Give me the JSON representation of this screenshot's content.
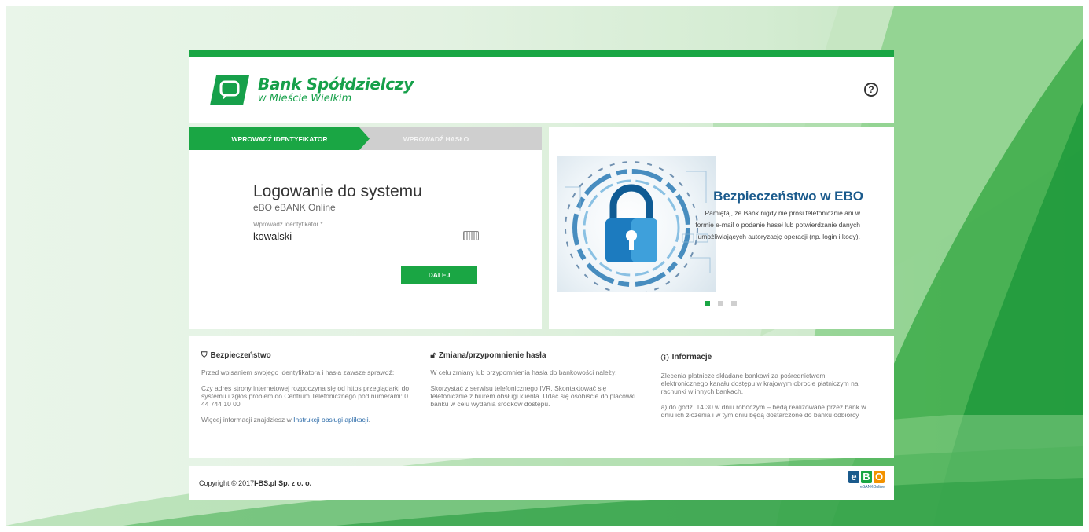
{
  "brand": {
    "name": "Bank Spółdzielczy",
    "subtitle": "w Mieście Wielkim"
  },
  "steps": {
    "active": "WPROWADŹ IDENTYFIKATOR",
    "inactive": "WPROWADŹ HASŁO"
  },
  "login": {
    "title": "Logowanie do systemu",
    "subtitle": "eBO eBANK Online",
    "field_label": "Wprowadź identyfikator *",
    "field_value": "kowalski",
    "next_button": "DALEJ"
  },
  "promo": {
    "title": "Bezpieczeństwo w EBO",
    "text": "Pamiętaj, że Bank nigdy nie prosi telefonicznie ani w formie e-mail o podanie haseł lub potwierdzanie danych umożliwiających autoryzację operacji (np. login i kody).",
    "slides": 3,
    "active_slide": 1
  },
  "info": {
    "security": {
      "title": "Bezpieczeństwo",
      "p1": "Przed wpisaniem swojego identyfikatora i hasła zawsze sprawdź:",
      "p2": "Czy adres strony internetowej rozpoczyna się od https przeglądarki do systemu i zgłoś problem do Centrum Telefonicznego pod numerami: 0 44 744 10 00",
      "p3_prefix": "Więcej informacji znajdziesz w ",
      "p3_link": "Instrukcji obsługi aplikacji",
      "p3_suffix": "."
    },
    "password": {
      "title": "Zmiana/przypomnienie hasła",
      "p1": "W celu zmiany lub przypomnienia hasła do bankowości należy:",
      "p2": "Skorzystać z serwisu telefonicznego IVR. Skontaktować się telefonicznie z biurem obsługi klienta. Udać się osobiście do placówki banku w celu wydania środków dostępu."
    },
    "information": {
      "title": "Informacje",
      "p1": "Zlecenia płatnicze składane bankowi za pośrednictwem elektronicznego kanału dostępu w krajowym obrocie płatniczym na rachunki w innych bankach.",
      "p2": "a) do godz. 14.30 w dniu roboczym – będą realizowane przez bank w dniu ich złożenia i w tym dniu będą dostarczone do banku odbiorcy"
    }
  },
  "footer": {
    "copyright_prefix": "Copyright © 2017 ",
    "copyright_company": "I-BS.pl Sp. z o. o.",
    "ebo_e": "e",
    "ebo_b": "B",
    "ebo_o": "O",
    "ebo_sub": "eBANKOnline"
  },
  "colors": {
    "brand_green": "#1aa644",
    "ebo_blue": "#1a5a8c",
    "ebo_orange": "#f39200"
  }
}
